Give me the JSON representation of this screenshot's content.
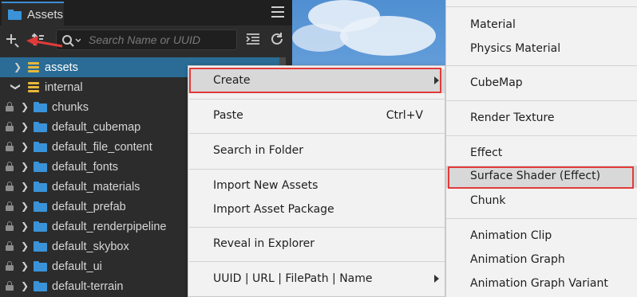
{
  "panel": {
    "tab_title": "Assets"
  },
  "toolbar": {
    "search_placeholder": "Search Name or UUID"
  },
  "tree": [
    {
      "label": "assets",
      "locked": false,
      "indent": 0,
      "icon": "database-icon",
      "selected": true
    },
    {
      "label": "internal",
      "locked": false,
      "indent": 0,
      "icon": "database-icon",
      "expanded": true
    },
    {
      "label": "chunks",
      "locked": true,
      "indent": 1,
      "icon": "folder-icon"
    },
    {
      "label": "default_cubemap",
      "locked": true,
      "indent": 1,
      "icon": "folder-icon"
    },
    {
      "label": "default_file_content",
      "locked": true,
      "indent": 1,
      "icon": "folder-icon"
    },
    {
      "label": "default_fonts",
      "locked": true,
      "indent": 1,
      "icon": "folder-icon"
    },
    {
      "label": "default_materials",
      "locked": true,
      "indent": 1,
      "icon": "folder-icon"
    },
    {
      "label": "default_prefab",
      "locked": true,
      "indent": 1,
      "icon": "folder-icon"
    },
    {
      "label": "default_renderpipeline",
      "locked": true,
      "indent": 1,
      "icon": "folder-icon"
    },
    {
      "label": "default_skybox",
      "locked": true,
      "indent": 1,
      "icon": "folder-icon"
    },
    {
      "label": "default_ui",
      "locked": true,
      "indent": 1,
      "icon": "folder-icon"
    },
    {
      "label": "default-terrain",
      "locked": true,
      "indent": 1,
      "icon": "folder-icon"
    }
  ],
  "context_menu": {
    "create": "Create",
    "paste": "Paste",
    "paste_shortcut": "Ctrl+V",
    "search_in_folder": "Search in Folder",
    "import_new_assets": "Import New Assets",
    "import_asset_package": "Import Asset Package",
    "reveal_in_explorer": "Reveal in Explorer",
    "uuid_url": "UUID | URL | FilePath | Name"
  },
  "submenu": {
    "material": "Material",
    "physics_material": "Physics Material",
    "cubemap": "CubeMap",
    "render_texture": "Render Texture",
    "effect": "Effect",
    "surface_shader": "Surface Shader (Effect)",
    "chunk": "Chunk",
    "animation_clip": "Animation Clip",
    "animation_graph": "Animation Graph",
    "animation_graph_variant": "Animation Graph Variant"
  },
  "colors": {
    "selected_row": "#2a6c95",
    "folder": "#3a93d8",
    "database": "#e8b73a",
    "annotation_red": "#e23a3a"
  }
}
